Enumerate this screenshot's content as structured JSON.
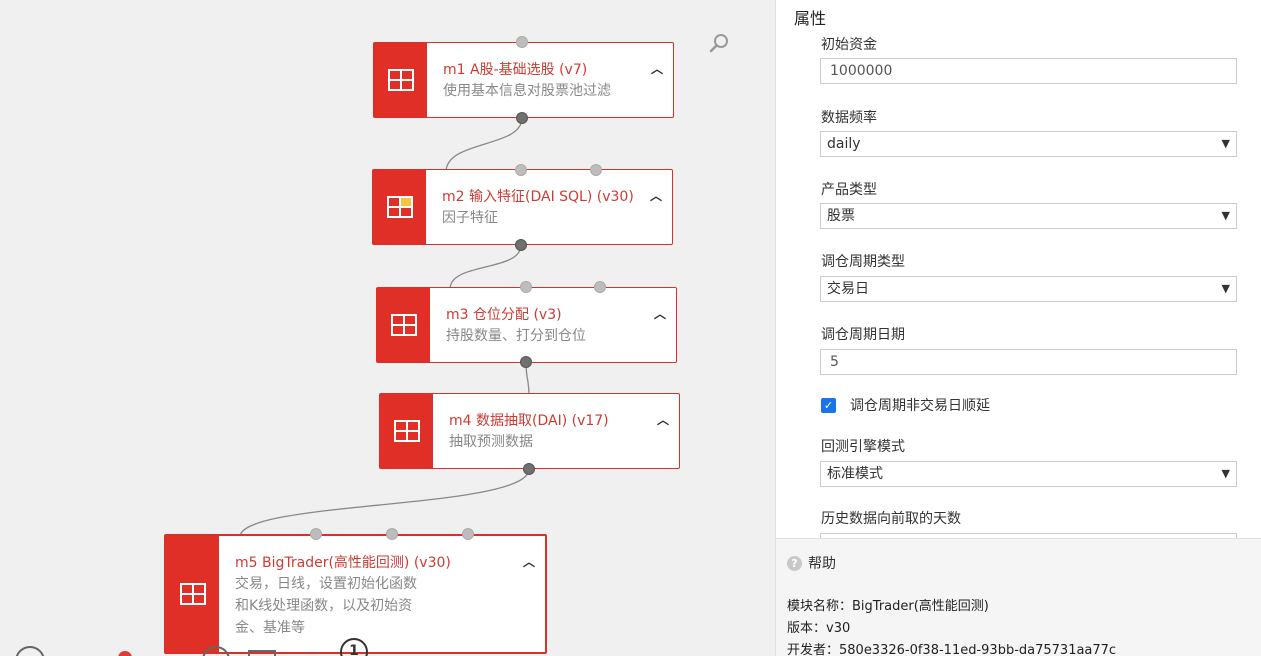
{
  "canvas": {
    "nodes": [
      {
        "id": "m1",
        "title": "m1 A股-基础选股 (v7)",
        "desc_lines": [
          "使用基本信息对股票池过滤"
        ]
      },
      {
        "id": "m2",
        "title": "m2 输入特征(DAI SQL) (v30)",
        "desc_lines": [
          "因子特征"
        ]
      },
      {
        "id": "m3",
        "title": "m3 仓位分配 (v3)",
        "desc_lines": [
          "持股数量、打分到仓位"
        ]
      },
      {
        "id": "m4",
        "title": "m4 数据抽取(DAI) (v17)",
        "desc_lines": [
          "抽取预测数据"
        ]
      },
      {
        "id": "m5",
        "title": "m5 BigTrader(高性能回测) (v30)",
        "desc_lines": [
          "交易，日线，设置初始化函数",
          "和K线处理函数，以及初始资",
          "金、基准等"
        ]
      }
    ],
    "toolbar_badge": "1"
  },
  "properties": {
    "title": "属性",
    "initial_capital": {
      "label": "初始资金",
      "value": "1000000"
    },
    "data_frequency": {
      "label": "数据频率",
      "value": "daily"
    },
    "product_type": {
      "label": "产品类型",
      "value": "股票"
    },
    "rebalance_type": {
      "label": "调仓周期类型",
      "value": "交易日"
    },
    "rebalance_days": {
      "label": "调仓周期日期",
      "value": "5"
    },
    "postpone_checkbox": {
      "label": "调仓周期非交易日顺延",
      "checked": true
    },
    "engine_mode": {
      "label": "回测引擎模式",
      "value": "标准模式"
    },
    "history_days": {
      "label": "历史数据向前取的天数"
    }
  },
  "help": {
    "title": "帮助",
    "module_name": "模块名称：BigTrader(高性能回测)",
    "version": "版本：v30",
    "developer": "开发者：580e3326-0f38-11ed-93bb-da75731aa77c"
  },
  "colors": {
    "accent": "#df2f26",
    "title_red": "#cf3b32",
    "checkbox": "#1a73e8"
  }
}
